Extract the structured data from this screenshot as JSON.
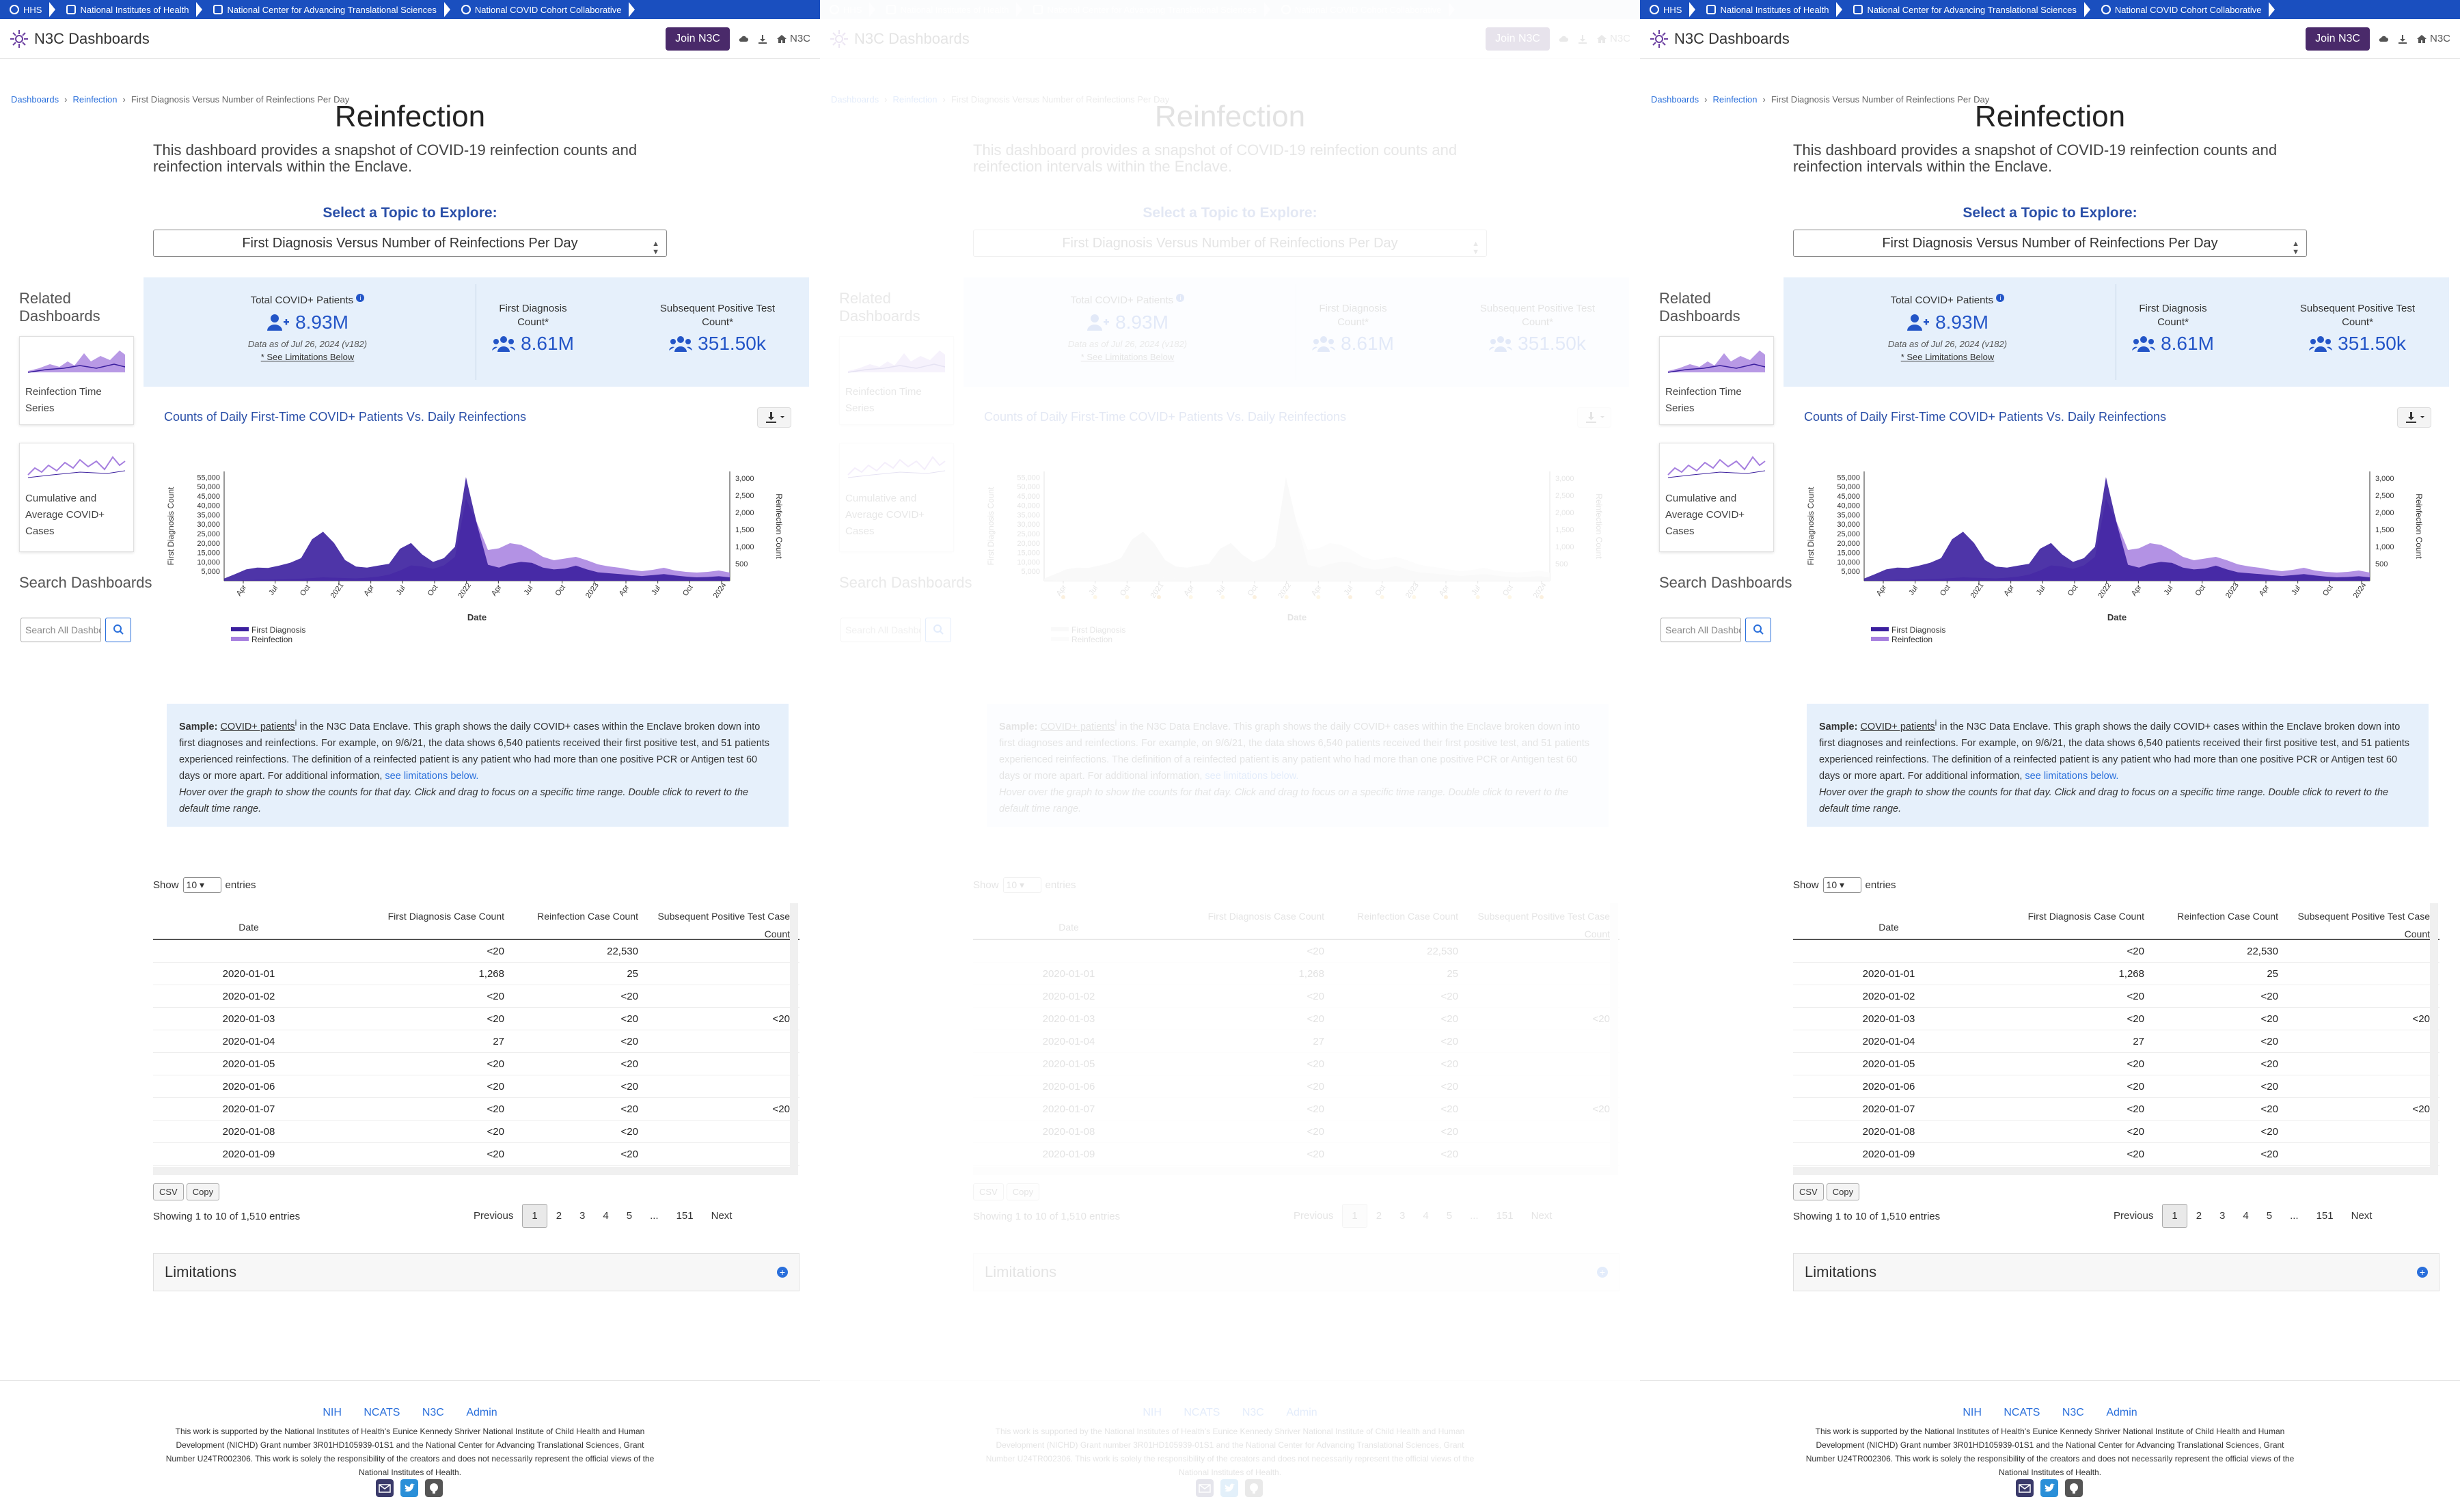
{
  "gov_bar": [
    "HHS",
    "National Institutes of Health",
    "National Center for Advancing Translational Sciences",
    "National COVID Cohort Collaborative"
  ],
  "nav": {
    "brand": "N3C Dashboards",
    "join": "Join N3C",
    "n3c": "N3C"
  },
  "breadcrumb": {
    "home": "Dashboards",
    "section": "Reinfection",
    "current": "First Diagnosis Versus Number of Reinfections Per Day"
  },
  "page": {
    "title": "Reinfection",
    "description": "This dashboard provides a snapshot of COVID-19 reinfection counts and reinfection intervals within the Enclave.",
    "topic_label": "Select a Topic to Explore:",
    "topic_value": "First Diagnosis Versus Number of Reinfections Per Day"
  },
  "sidebar": {
    "related_heading": "Related Dashboards",
    "related": [
      "Reinfection Time Series",
      "Cumulative and Average COVID+ Cases"
    ],
    "search_heading": "Search Dashboards",
    "search_placeholder": "Search All Dashboards"
  },
  "stats": {
    "total_label": "Total COVID+ Patients",
    "total_value": "8.93M",
    "date_note": "Data as of Jul 26, 2024 (v182)",
    "limitations_link": "* See Limitations Below",
    "first_label": "First Diagnosis Count*",
    "first_value": "8.61M",
    "subsequent_label": "Subsequent Positive Test Count*",
    "subsequent_value": "351.50k"
  },
  "chart_data": {
    "type": "area",
    "title": "Counts of Daily First-Time COVID+ Patients Vs. Daily Reinfections",
    "xlabel": "Date",
    "ylabel_left": "First Diagnosis Count",
    "ylabel_right": "Reinfection Count",
    "y_left_ticks": [
      "5,000",
      "10,000",
      "15,000",
      "20,000",
      "25,000",
      "30,000",
      "35,000",
      "40,000",
      "45,000",
      "50,000",
      "55,000"
    ],
    "y_right_ticks": [
      "500",
      "1,000",
      "1,500",
      "2,000",
      "2,500",
      "3,000"
    ],
    "ylim_left": [
      0,
      58000
    ],
    "ylim_right": [
      0,
      3200
    ],
    "x_ticks": [
      "Apr",
      "Jul",
      "Oct",
      "2021",
      "Apr",
      "Jul",
      "Oct",
      "2022",
      "Apr",
      "Jul",
      "Oct",
      "2023",
      "Apr",
      "Jul",
      "Oct",
      "2024"
    ],
    "legend": [
      "First Diagnosis",
      "Reinfection"
    ],
    "legend_position": "bottom-left",
    "colors": {
      "first": "#3b1f9e",
      "reinfection": "#a67fdf"
    },
    "series": [
      {
        "name": "First Diagnosis",
        "values": [
          1200,
          3500,
          6000,
          7000,
          6800,
          8000,
          9500,
          12000,
          22000,
          26000,
          20000,
          11000,
          7500,
          7000,
          8000,
          9000,
          17000,
          20000,
          14000,
          10000,
          12000,
          18000,
          55000,
          30000,
          8500,
          7000,
          9000,
          10000,
          9500,
          7000,
          6000,
          6500,
          8000,
          6000,
          4500,
          4000,
          3500,
          3000,
          2500,
          3000,
          3500,
          2800,
          2200,
          1800,
          2000,
          2400,
          1800
        ]
      },
      {
        "name": "Reinfection",
        "values": [
          0,
          10,
          20,
          30,
          30,
          40,
          50,
          60,
          80,
          100,
          90,
          80,
          70,
          90,
          120,
          180,
          300,
          450,
          420,
          350,
          450,
          700,
          2400,
          1700,
          900,
          950,
          1100,
          1050,
          900,
          700,
          600,
          650,
          700,
          600,
          480,
          420,
          380,
          320,
          280,
          320,
          380,
          300,
          260,
          240,
          260,
          300,
          240
        ]
      }
    ]
  },
  "info": {
    "sample": "Sample:",
    "sample_link": "COVID+ patients",
    "text": " in the N3C Data Enclave. This graph shows the daily COVID+ cases within the Enclave broken down into first diagnoses and reinfections. For example, on 9/6/21, the data shows 6,540 patients received their first positive test, and 51 patients experienced reinfections. The definition of a reinfected patient is any patient who had more than one positive PCR or Antigen test 60 days or more apart. For additional information, ",
    "limitations_link": "see limitations below.",
    "hint": "Hover over the graph to show the counts for that day. Click and drag to focus on a specific time range. Double click to revert to the default time range."
  },
  "table": {
    "show_label": "Show",
    "entries_value": "10",
    "entries_label": "entries",
    "headers": [
      "Date",
      "First Diagnosis Case Count",
      "Reinfection Case Count",
      "Subsequent Positive Test Case Count"
    ],
    "rows": [
      [
        "",
        "<20",
        "22,530",
        ""
      ],
      [
        "2020-01-01",
        "1,268",
        "25",
        ""
      ],
      [
        "2020-01-02",
        "<20",
        "<20",
        ""
      ],
      [
        "2020-01-03",
        "<20",
        "<20",
        "<20"
      ],
      [
        "2020-01-04",
        "27",
        "<20",
        ""
      ],
      [
        "2020-01-05",
        "<20",
        "<20",
        ""
      ],
      [
        "2020-01-06",
        "<20",
        "<20",
        ""
      ],
      [
        "2020-01-07",
        "<20",
        "<20",
        "<20"
      ],
      [
        "2020-01-08",
        "<20",
        "<20",
        ""
      ],
      [
        "2020-01-09",
        "<20",
        "<20",
        ""
      ]
    ],
    "buttons": [
      "CSV",
      "Copy"
    ],
    "showing": "Showing 1 to 10 of 1,510 entries",
    "pager": [
      "Previous",
      "1",
      "2",
      "3",
      "4",
      "5",
      "...",
      "151",
      "Next"
    ]
  },
  "limitations": {
    "title": "Limitations"
  },
  "footer": {
    "links": [
      "NIH",
      "NCATS",
      "N3C",
      "Admin"
    ],
    "text": "This work is supported by the National Institutes of Health's Eunice Kennedy Shriver National Institute of Child Health and Human Development (NICHD) Grant number 3R01HD105939-01S1 and the National Center for Advancing Translational Sciences, Grant Number U24TR002306. This work is solely the responsibility of the creators and does not necessarily represent the official views of the National Institutes of Health."
  }
}
